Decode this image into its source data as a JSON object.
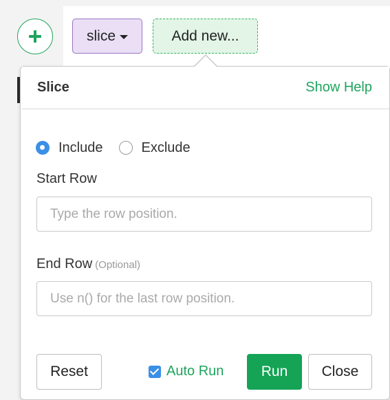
{
  "toolbar": {
    "add_icon": "plus-icon",
    "slice_chip_label": "slice",
    "add_new_label": "Add new..."
  },
  "popover": {
    "title": "Slice",
    "show_help": "Show Help",
    "radio_options": [
      {
        "label": "Include",
        "checked": true
      },
      {
        "label": "Exclude",
        "checked": false
      }
    ],
    "start_row": {
      "label": "Start Row",
      "placeholder": "Type the row position.",
      "value": ""
    },
    "end_row": {
      "label": "End Row",
      "optional": "(Optional)",
      "placeholder": "Use n() for the last row position.",
      "value": ""
    },
    "buttons": {
      "reset": "Reset",
      "auto_run": "Auto Run",
      "run": "Run",
      "close": "Close"
    },
    "auto_run_checked": true
  },
  "colors": {
    "accent_green": "#1ea45c",
    "run_button": "#15a356",
    "radio_blue": "#3b8fe6",
    "slice_chip_bg": "#eadff5",
    "slice_chip_border": "#9b73c4",
    "add_new_bg": "#e2f5e6"
  }
}
